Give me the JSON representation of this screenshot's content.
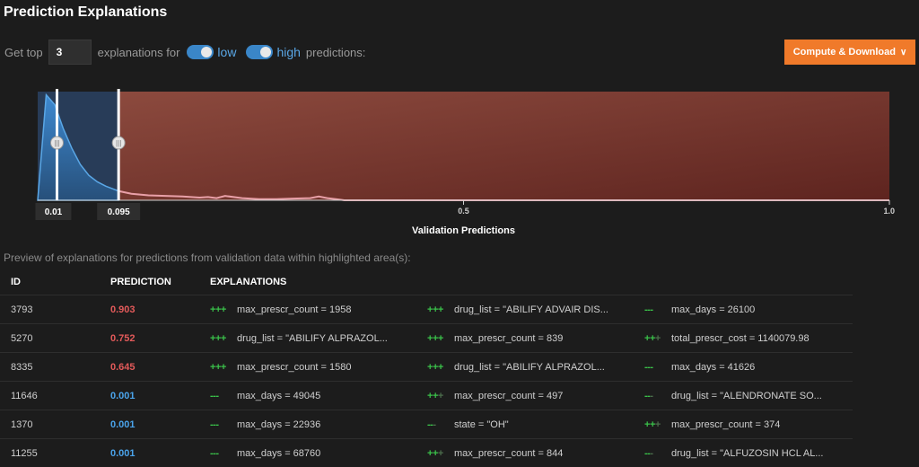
{
  "title": "Prediction Explanations",
  "controls": {
    "get_top": "Get top",
    "top_n": "3",
    "explanations_for": "explanations for",
    "low_label": "low",
    "high_label": "high",
    "predictions": "predictions:",
    "compute_button": "Compute & Download"
  },
  "chart_data": {
    "type": "area",
    "xlabel": "Validation Predictions",
    "xlim": [
      0,
      1
    ],
    "x_ticks": [
      "0.5",
      "1.0"
    ],
    "thresholds": {
      "low": 0.01,
      "low_label": "0.01",
      "high": 0.095,
      "high_label": "0.095"
    },
    "x": [
      0,
      0.01,
      0.02,
      0.03,
      0.04,
      0.05,
      0.06,
      0.07,
      0.08,
      0.09,
      0.095,
      0.11,
      0.13,
      0.15,
      0.17,
      0.19,
      0.2,
      0.21,
      0.22,
      0.24,
      0.26,
      0.28,
      0.3,
      0.32,
      0.33,
      0.34,
      0.35,
      0.36,
      1.0
    ],
    "density": [
      0.0,
      0.97,
      0.88,
      0.66,
      0.48,
      0.33,
      0.23,
      0.17,
      0.13,
      0.1,
      0.085,
      0.06,
      0.045,
      0.04,
      0.035,
      0.025,
      0.03,
      0.02,
      0.04,
      0.02,
      0.01,
      0.01,
      0.015,
      0.02,
      0.035,
      0.02,
      0.01,
      0.0,
      0.0
    ],
    "colors": {
      "low": "#3d89d0",
      "high": "#7a3a32",
      "highline": "#e34848"
    }
  },
  "preview_text": "Preview of explanations for predictions from validation data within highlighted area(s):",
  "table": {
    "headers": [
      "ID",
      "PREDICTION",
      "EXPLANATIONS"
    ],
    "rows": [
      {
        "id": "3793",
        "pred": "0.903",
        "e1s": "+++",
        "e1": "max_prescr_count = 1958",
        "e2s": "+++",
        "e2": "drug_list = \"ABILIFY ADVAIR DIS...",
        "e3s": "---",
        "e3": "max_days = 26100"
      },
      {
        "id": "5270",
        "pred": "0.752",
        "e1s": "+++",
        "e1": "drug_list = \"ABILIFY ALPRAZOL...",
        "e2s": "+++",
        "e2": "max_prescr_count = 839",
        "e3s": "++",
        "e3": "total_prescr_cost = 1140079.98"
      },
      {
        "id": "8335",
        "pred": "0.645",
        "e1s": "+++",
        "e1": "max_prescr_count = 1580",
        "e2s": "+++",
        "e2": "drug_list = \"ABILIFY ALPRAZOL...",
        "e3s": "---",
        "e3": "max_days = 41626"
      },
      {
        "id": "11646",
        "pred": "0.001",
        "e1s": "---",
        "e1": "max_days = 49045",
        "e2s": "++",
        "e2": "max_prescr_count = 497",
        "e3s": "--",
        "e3": "drug_list = \"ALENDRONATE SO..."
      },
      {
        "id": "1370",
        "pred": "0.001",
        "e1s": "---",
        "e1": "max_days = 22936",
        "e2s": "--",
        "e2": "state = \"OH\"",
        "e3s": "++",
        "e3": "max_prescr_count = 374"
      },
      {
        "id": "11255",
        "pred": "0.001",
        "e1s": "---",
        "e1": "max_days = 68760",
        "e2s": "++",
        "e2": "max_prescr_count = 844",
        "e3s": "--",
        "e3": "drug_list = \"ALFUZOSIN HCL AL..."
      }
    ]
  }
}
